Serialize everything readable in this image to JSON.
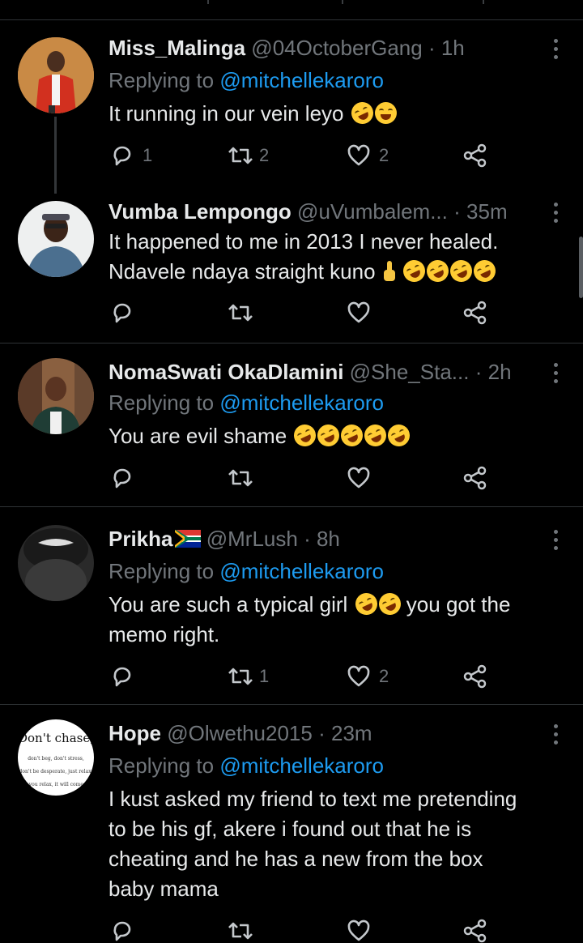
{
  "tweets": [
    {
      "name": "Miss_Malinga",
      "handle": "@04OctoberGang",
      "dot": "·",
      "time": "1h",
      "replying_prefix": "Replying to ",
      "replying_to": "@mitchellekaroro",
      "text": "It running in our vein leyo",
      "emojis": [
        "face-with-tears-of-joy",
        "face-with-tears-of-joy"
      ],
      "reply_count": "1",
      "retweet_count": "2",
      "like_count": "2",
      "share_count": ""
    },
    {
      "name": "Vumba Lempongo",
      "handle": "@uVumbalem...",
      "dot": "·",
      "time": "35m",
      "text_line1": "It happened to me in 2013 I never healed.",
      "text_line2": "Ndavele ndaya straight kuno",
      "emojis": [
        "index-pointing-up",
        "rolling-on-floor-laughing",
        "rolling-on-floor-laughing",
        "rolling-on-floor-laughing",
        "rolling-on-floor-laughing"
      ],
      "reply_count": "",
      "retweet_count": "",
      "like_count": "",
      "share_count": ""
    },
    {
      "name": "NomaSwati OkaDlamini",
      "handle": "@She_Sta...",
      "dot": "·",
      "time": "2h",
      "replying_prefix": "Replying to ",
      "replying_to": "@mitchellekaroro",
      "text": "You are evil shame",
      "emojis": [
        "face-with-tears-of-joy",
        "face-with-tears-of-joy",
        "face-with-tears-of-joy",
        "face-with-tears-of-joy",
        "face-with-tears-of-joy"
      ],
      "reply_count": "",
      "retweet_count": "",
      "like_count": "",
      "share_count": ""
    },
    {
      "name": "Prikha",
      "flag": "south-africa-flag",
      "handle": "@MrLush",
      "dot": "·",
      "time": "8h",
      "replying_prefix": "Replying to ",
      "replying_to": "@mitchellekaroro",
      "text_before": "You are such a typical girl",
      "text_after": "you got the",
      "text_line2": "memo right.",
      "emojis": [
        "face-with-tears-of-joy",
        "rolling-on-floor-laughing"
      ],
      "reply_count": "",
      "retweet_count": "1",
      "like_count": "2",
      "share_count": ""
    },
    {
      "name": "Hope",
      "handle": "@Olwethu2015",
      "dot": "·",
      "time": "23m",
      "replying_prefix": "Replying to ",
      "replying_to": "@mitchellekaroro",
      "text_line1": "I kust asked my friend to text me pretending",
      "text_line2": "to be his gf, akere i found out that he is",
      "text_line3": "cheating and he has a new from the box",
      "text_line4": "baby mama",
      "avatar_text": {
        "line1": "Don't chase,",
        "line2": "don't beg, don't stress,",
        "line3": "don't be desperate, just relax.",
        "line4": "as you relax, it will come to"
      },
      "reply_count": "",
      "retweet_count": "",
      "like_count": "",
      "share_count": ""
    }
  ],
  "colors": {
    "background": "#000000",
    "text": "#e7e9ea",
    "secondary": "#71767b",
    "mention": "#1d9bf0",
    "divider": "#2f3336"
  }
}
